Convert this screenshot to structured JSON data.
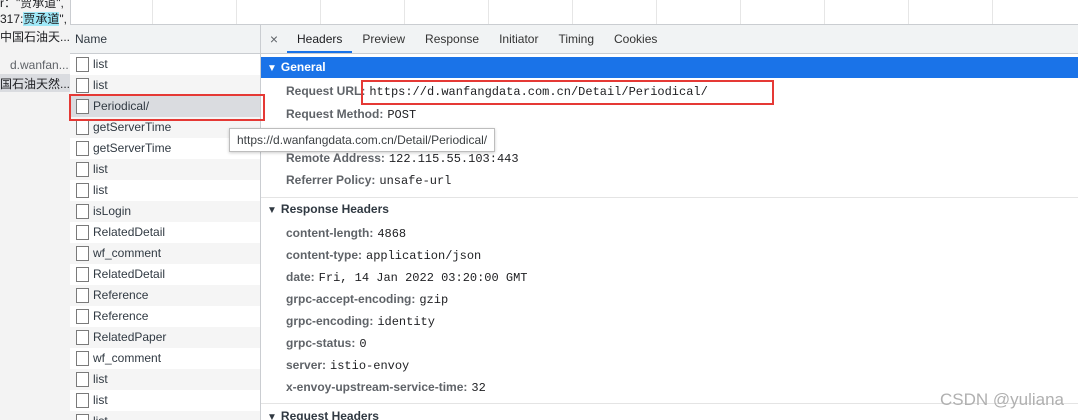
{
  "left_clip": {
    "lines": [
      {
        "pre": "",
        "hl": "",
        "post": "",
        "raw": "r：\"贾承道\","
      },
      {
        "pre": "317:",
        "hl": "贾承道",
        "post": "\",",
        "raw": ""
      },
      {
        "pre": "",
        "hl": "",
        "post": "",
        "raw": "中国石油天..."
      },
      {
        "pre": "",
        "hl": "",
        "post": "",
        "raw": "d.wanfan..."
      },
      {
        "pre": "",
        "hl": "",
        "post": "",
        "raw": "国石油天然..."
      }
    ]
  },
  "name_column": {
    "header": "Name",
    "rows": [
      {
        "label": "list"
      },
      {
        "label": "list"
      },
      {
        "label": "Periodical/"
      },
      {
        "label": "getServerTime"
      },
      {
        "label": "getServerTime"
      },
      {
        "label": "list"
      },
      {
        "label": "list"
      },
      {
        "label": "isLogin"
      },
      {
        "label": "RelatedDetail"
      },
      {
        "label": "wf_comment"
      },
      {
        "label": "RelatedDetail"
      },
      {
        "label": "Reference"
      },
      {
        "label": "Reference"
      },
      {
        "label": "RelatedPaper"
      },
      {
        "label": "wf_comment"
      },
      {
        "label": "list"
      },
      {
        "label": "list"
      },
      {
        "label": "list"
      }
    ]
  },
  "tabs": {
    "close": "×",
    "items": [
      "Headers",
      "Preview",
      "Response",
      "Initiator",
      "Timing",
      "Cookies"
    ],
    "active": "Headers"
  },
  "general": {
    "title": "General",
    "rows": [
      {
        "key": "Request URL:",
        "value": "https://d.wanfangdata.com.cn/Detail/Periodical/"
      },
      {
        "key": "Request Method:",
        "value": "POST"
      },
      {
        "key": "Remote Address:",
        "value": "122.115.55.103:443"
      },
      {
        "key": "Referrer Policy:",
        "value": "unsafe-url"
      }
    ]
  },
  "response_headers": {
    "title": "Response Headers",
    "rows": [
      {
        "key": "content-length:",
        "value": "4868"
      },
      {
        "key": "content-type:",
        "value": "application/json"
      },
      {
        "key": "date:",
        "value": "Fri, 14 Jan 2022 03:20:00 GMT"
      },
      {
        "key": "grpc-accept-encoding:",
        "value": "gzip"
      },
      {
        "key": "grpc-encoding:",
        "value": "identity"
      },
      {
        "key": "grpc-status:",
        "value": "0"
      },
      {
        "key": "server:",
        "value": "istio-envoy"
      },
      {
        "key": "x-envoy-upstream-service-time:",
        "value": "32"
      }
    ]
  },
  "request_headers": {
    "title": "Request Headers"
  },
  "tooltip": "https://d.wanfangdata.com.cn/Detail/Periodical/",
  "watermark": "CSDN @yuliana",
  "colors": {
    "accent": "#1a73e8",
    "highlight_box": "#e53935"
  }
}
